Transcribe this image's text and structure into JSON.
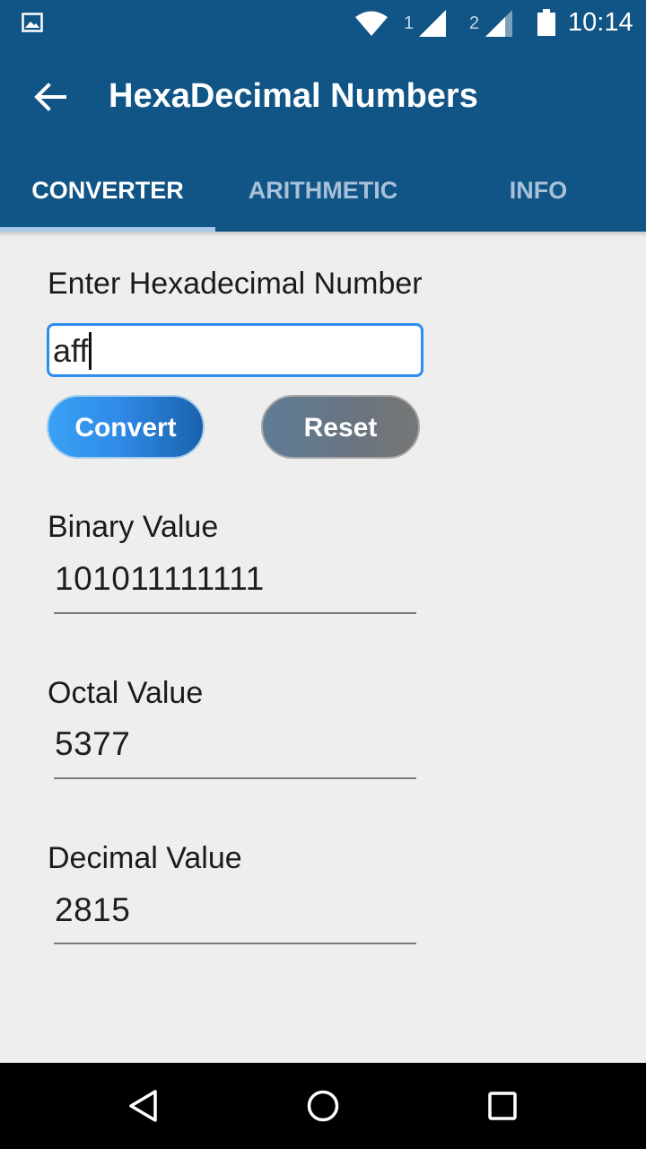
{
  "status_bar": {
    "time": "10:14",
    "sim1": "1",
    "sim2": "2",
    "icons": [
      "gallery-icon",
      "wifi-icon",
      "signal-icon",
      "signal-icon",
      "battery-icon"
    ]
  },
  "app_bar": {
    "title": "HexaDecimal Numbers",
    "back_icon": "arrow-left-icon"
  },
  "tabs": [
    {
      "label": "CONVERTER",
      "selected": true
    },
    {
      "label": "ARITHMETIC",
      "selected": false
    },
    {
      "label": "INFO",
      "selected": false
    }
  ],
  "converter": {
    "input_label": "Enter Hexadecimal Number",
    "input_value": "aff",
    "convert_label": "Convert",
    "reset_label": "Reset",
    "binary_label": "Binary Value",
    "binary_value": "101011111111",
    "octal_label": "Octal Value",
    "octal_value": "5377",
    "decimal_label": "Decimal Value",
    "decimal_value": "2815"
  },
  "nav_bar": {
    "icons": [
      "nav-back-icon",
      "nav-home-icon",
      "nav-recents-icon"
    ]
  },
  "colors": {
    "primary": "#115586",
    "accent": "#2c8cf0",
    "tab_indicator": "#a8c8e8"
  }
}
